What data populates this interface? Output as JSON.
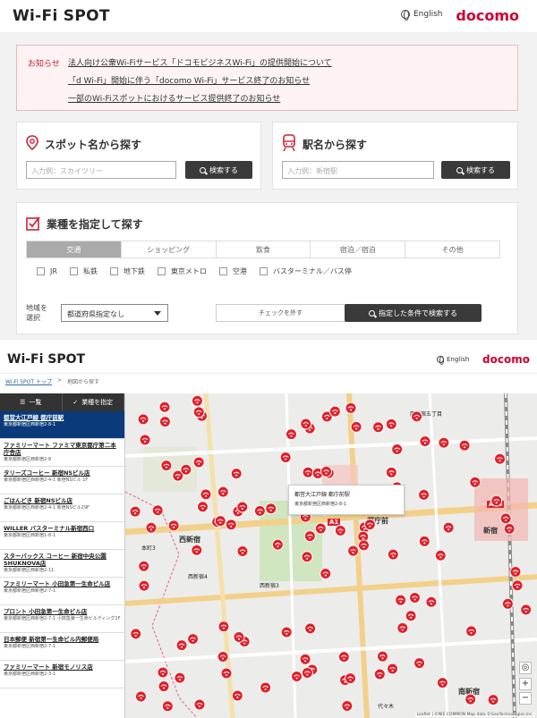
{
  "header": {
    "logo": "Wi-Fi SPOT",
    "lang": "English",
    "brand": "docomo"
  },
  "notice": {
    "tag": "お知らせ",
    "links": [
      "法人向け公衆Wi-Fiサービス「ドコモビジネスWi-Fi」の提供開始について",
      "「d Wi-Fi」開始に伴う「docomo Wi-Fi」サービス終了のお知らせ",
      "一部のWi-Fiスポットにおけるサービス提供終了のお知らせ"
    ]
  },
  "spot_search": {
    "title": "スポット名から探す",
    "placeholder": "入力例：スカイツリー",
    "button": "検索する"
  },
  "station_search": {
    "title": "駅名から探す",
    "placeholder": "入力例：新宿駅",
    "button": "検索する"
  },
  "category_search": {
    "title": "業種を指定して探す",
    "tabs": [
      "交通",
      "ショッピング",
      "飲食",
      "宿泊／宿泊",
      "その他"
    ],
    "checks": [
      "JR",
      "私鉄",
      "地下鉄",
      "東京メトロ",
      "空港",
      "バスターミナル／バス停"
    ],
    "region_label_1": "地域を",
    "region_label_2": "選択",
    "region_value": "都道府県指定なし",
    "clear_button": "チェックを外す",
    "search_button": "指定した条件で検索する"
  },
  "map_page": {
    "logo": "Wi-Fi SPOT",
    "lang": "English",
    "brand": "docomo",
    "crumb_home": "Wi-Fi SPOT トップ",
    "crumb_sep": ">",
    "crumb_current": "地図から探す",
    "sidebar_tab_list": "一覧",
    "sidebar_tab_filter": "業種を指定",
    "list": [
      {
        "name": "都営大江戸線 都庁前駅",
        "address": "東京都新宿区西新宿2-8-1"
      },
      {
        "name": "ファミリーマート ファミマ東京都庁第二本庁舎店",
        "address": "東京都新宿区西新宿2-8"
      },
      {
        "name": "タリーズコーヒー 新宿NSビル店",
        "address": "東京都新宿区西新宿2-4-1 新宿NSビル 1F"
      },
      {
        "name": "ごはんどき 新宿NSビル店",
        "address": "東京都新宿区西新宿2-4-1 新宿NSビル29F"
      },
      {
        "name": "WILLER バスターミナル新宿西口",
        "address": "東京都新宿区西新宿1-8-1"
      },
      {
        "name": "スターバックス コーヒー 新宿中央公園SHUKNOVA店",
        "address": "東京都新宿区西新宿2-11"
      },
      {
        "name": "ファミリーマート 小田急第一生命ビル店",
        "address": "東京都新宿区西新宿2-7-1"
      },
      {
        "name": "プロント 小田急第一生命ビル店",
        "address": "東京都新宿区西新宿2-7-1 小田急第一生命ビルディング1F"
      },
      {
        "name": "日本郵便 新宿第一生命ビル内郵便局",
        "address": "東京都新宿区西新宿2-7-1"
      },
      {
        "name": "ファミリーマート 新宿モノリス店",
        "address": "東京都新宿区西新宿2-3-1"
      }
    ],
    "popup_name": "都営大江戸線 都庁前駅",
    "popup_address": "東京都新宿区西新宿2-8-1",
    "zoom_in": "+",
    "zoom_out": "−",
    "attribution": "Leaflet | ©NIE COMMON Map data ©GeoTechnologies,Inc.",
    "labels": {
      "nishishinjuku": "西新宿",
      "tochomae": "都庁前",
      "shinjuku": "新宿",
      "nishishinjuku5": "西新宿五丁目",
      "nishishinjuku3": "西新宿3",
      "nishishinjuku4": "西新宿4",
      "yoyogi": "代々木",
      "minamishinjuku": "南新宿",
      "honcho": "本町3",
      "mapkey_a": "A16",
      "mapkey_b": "A1"
    }
  }
}
